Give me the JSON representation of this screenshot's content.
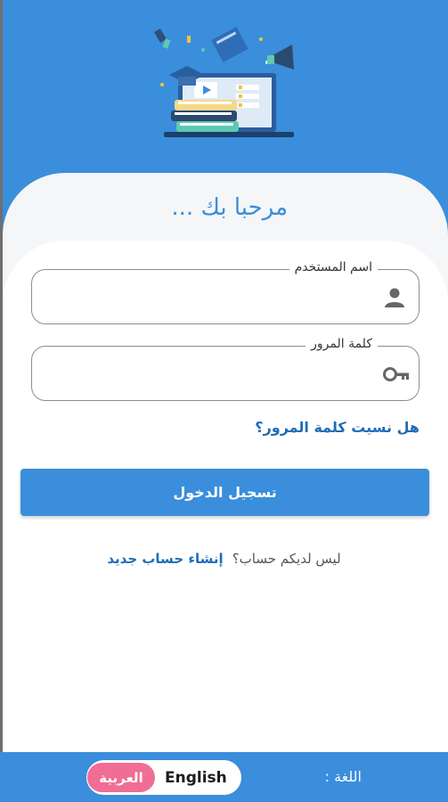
{
  "hero": {
    "illustration": "education-illustration"
  },
  "welcome_title": "مرحبا بك ...",
  "form": {
    "username": {
      "label": "اسم المستخدم",
      "value": "",
      "icon": "person-icon"
    },
    "password": {
      "label": "كلمة المرور",
      "value": "",
      "icon": "key-icon"
    },
    "forgot_password": "هل نسيت كلمة المرور؟",
    "login_button": "تسجيل الدخول"
  },
  "signup": {
    "question": "ليس لديكم حساب؟",
    "link": "إنشاء حساب جديد"
  },
  "footer": {
    "language_label": "اللغة :",
    "options": [
      "العربية",
      "English"
    ],
    "selected": "العربية"
  },
  "colors": {
    "primary": "#3a8edb",
    "link": "#1f6cb7",
    "accent": "#f06d96"
  }
}
